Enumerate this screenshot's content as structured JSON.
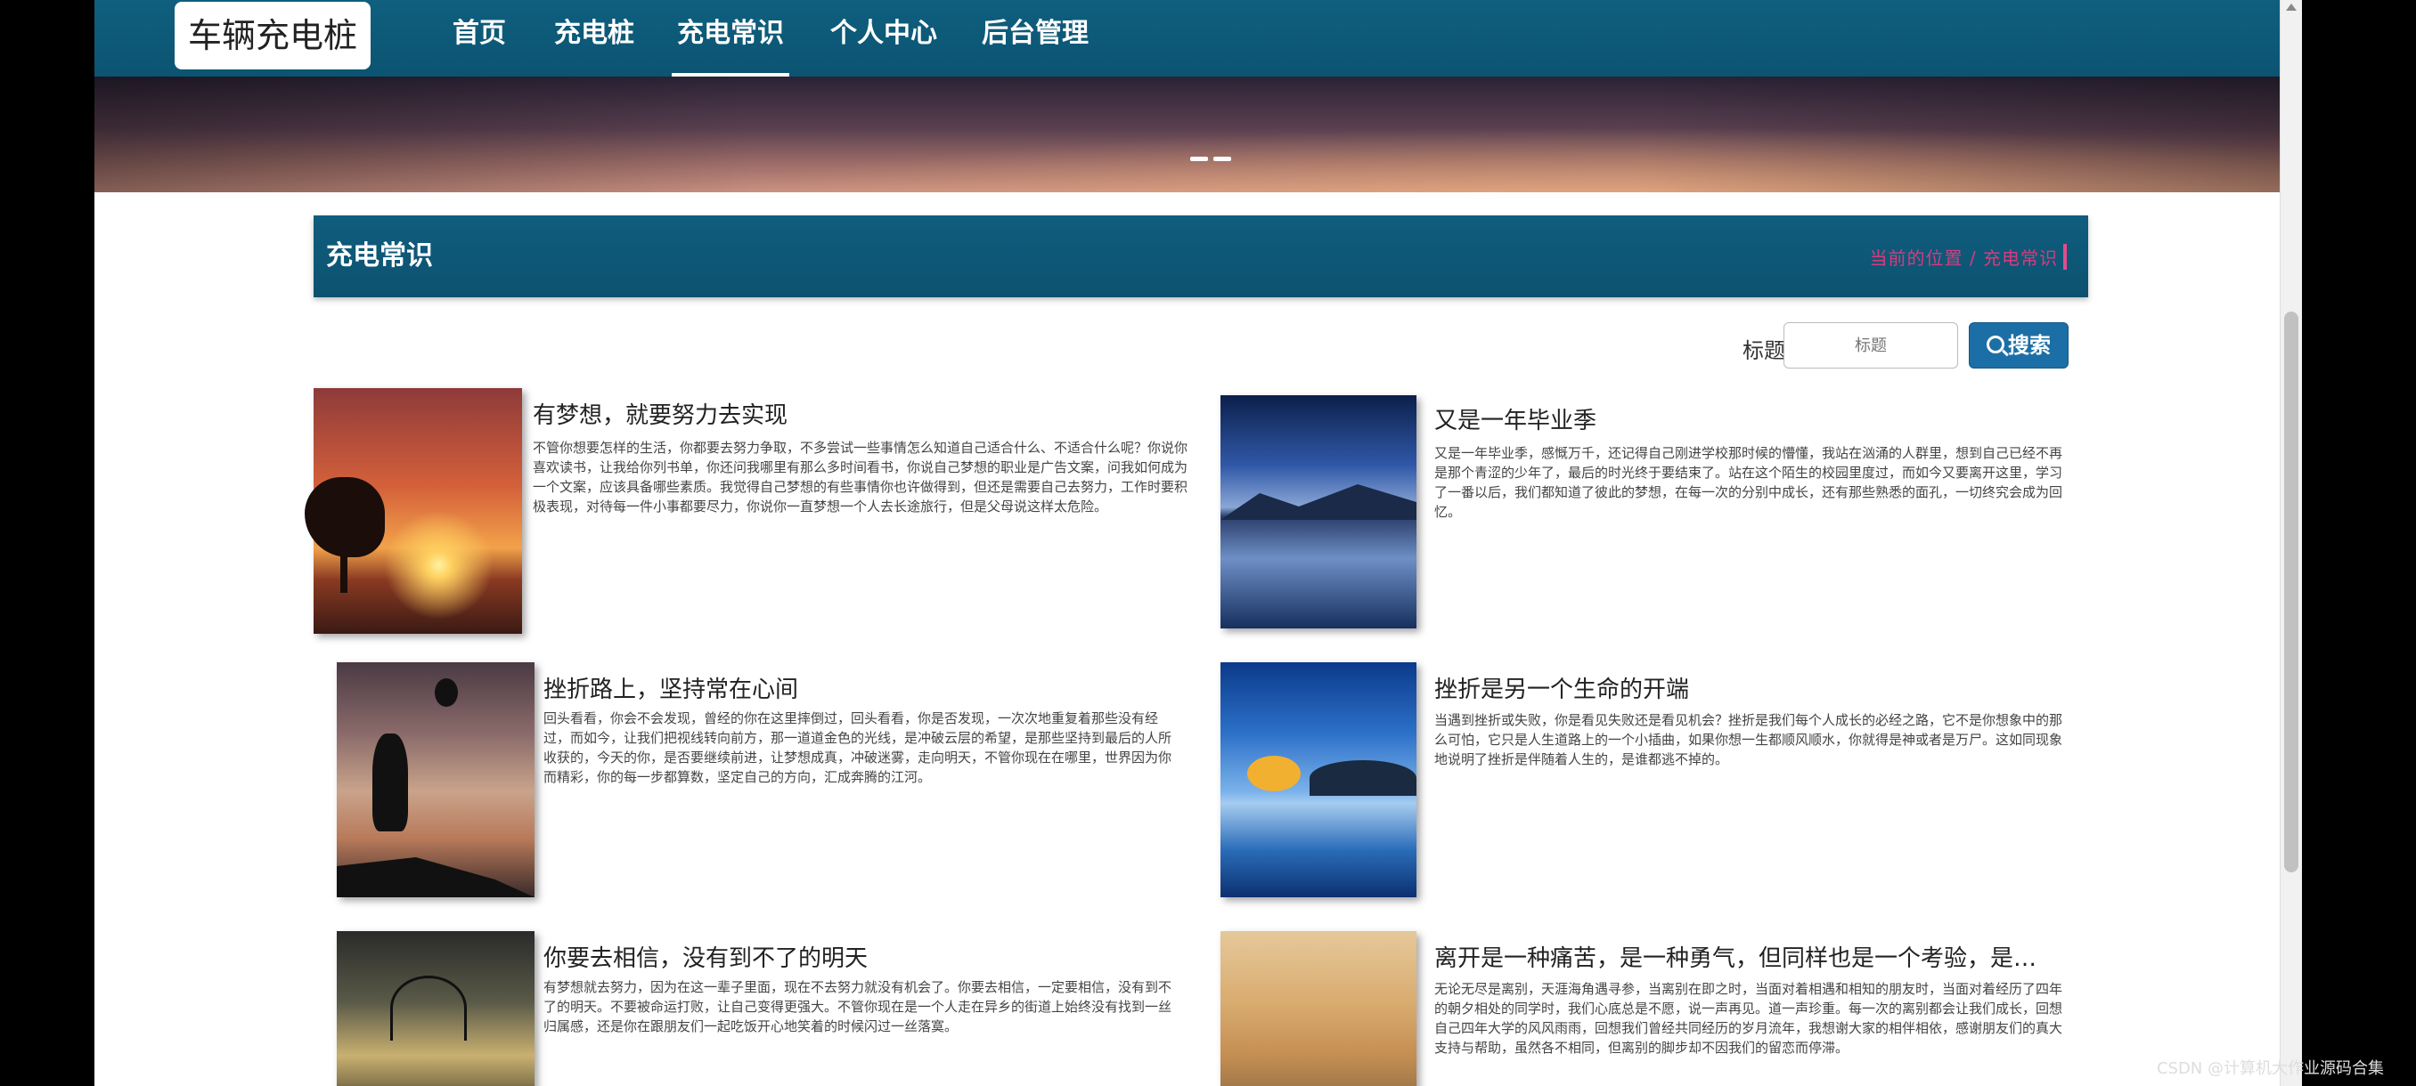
{
  "nav": {
    "logo": "车辆充电桩",
    "items": [
      "首页",
      "充电桩",
      "充电常识",
      "个人中心",
      "后台管理"
    ],
    "active_index": 2
  },
  "banner": {
    "dots": 2
  },
  "section": {
    "title": "充电常识",
    "breadcrumb": "当前的位置 / 充电常识"
  },
  "search": {
    "label": "标题",
    "placeholder": "标题",
    "button": "搜索",
    "button_color": "#1c6fa6"
  },
  "articles": [
    {
      "title": "有梦想，就要努力去实现",
      "body": "不管你想要怎样的生活，你都要去努力争取，不多尝试一些事情怎么知道自己适合什么、不适合什么呢？你说你喜欢读书，让我给你列书单，你还问我哪里有那么多时间看书，你说自己梦想的职业是广告文案，问我如何成为一个文案，应该具备哪些素质。我觉得自己梦想的有些事情你也许做得到，但还是需要自己去努力，工作时要积极表现，对待每一件小事都要尽力，你说你一直梦想一个人去长途旅行，但是父母说这样太危险。",
      "thumb": "sunset"
    },
    {
      "title": "又是一年毕业季",
      "body": "又是一年毕业季，感慨万千，还记得自己刚进学校那时候的懵懂，我站在汹涌的人群里，想到自己已经不再是那个青涩的少年了，最后的时光终于要结束了。站在这个陌生的校园里度过，而如今又要离开这里，学习了一番以后，我们都知道了彼此的梦想，在每一次的分别中成长，还有那些熟悉的面孔，一切终究会成为回忆。",
      "thumb": "lake"
    },
    {
      "title": "挫折路上，坚持常在心间",
      "body": "回头看看，你会不会发现，曾经的你在这里摔倒过，回头看看，你是否发现，一次次地重复着那些没有经过，而如今，让我们把视线转向前方，那一道道金色的光线，是冲破云层的希望，是那些坚持到最后的人所收获的，今天的你，是否要继续前进，让梦想成真，冲破迷雾，走向明天，不管你现在在哪里，世界因为你而精彩，你的每一步都算数，坚定自己的方向，汇成奔腾的江河。",
      "thumb": "balloon"
    },
    {
      "title": "挫折是另一个生命的开端",
      "body": "当遇到挫折或失败，你是看见失败还是看见机会？挫折是我们每个人成长的必经之路，它不是你想象中的那么可怕，它只是人生道路上的一个小插曲，如果你想一生都顺风顺水，你就得是神或者是万尸。这如同现象地说明了挫折是伴随着人生的，是谁都逃不掉的。",
      "thumb": "blue"
    },
    {
      "title": "你要去相信，没有到不了的明天",
      "body": "有梦想就去努力，因为在这一辈子里面，现在不去努力就没有机会了。你要去相信，一定要相信，没有到不了的明天。不要被命运打败，让自己变得更强大。不管你现在是一个人走在异乡的街道上始终没有找到一丝归属感，还是你在跟朋友们一起吃饭开心地笑着的时候闪过一丝落寞。",
      "thumb": "dusk"
    },
    {
      "title": "离开是一种痛苦，是一种勇气，但同样也是一个考验，是一个新的...",
      "body": "无论无尽是离别，天涯海角遇寻参，当离别在即之时，当面对着相遇和相知的朋友时，当面对着经历了四年的朝夕相处的同学时，我们心底总是不愿，说一声再见。道一声珍重。每一次的离别都会让我们成长，回想自己四年大学的风风雨雨，回想我们曾经共同经历的岁月流年，我想谢大家的相伴相依，感谢朋友们的真大支持与帮助，虽然各不相同，但离别的脚步却不因我们的留恋而停滞。",
      "thumb": "sand"
    }
  ],
  "watermark": "CSDN @计算机大作业源码合集"
}
